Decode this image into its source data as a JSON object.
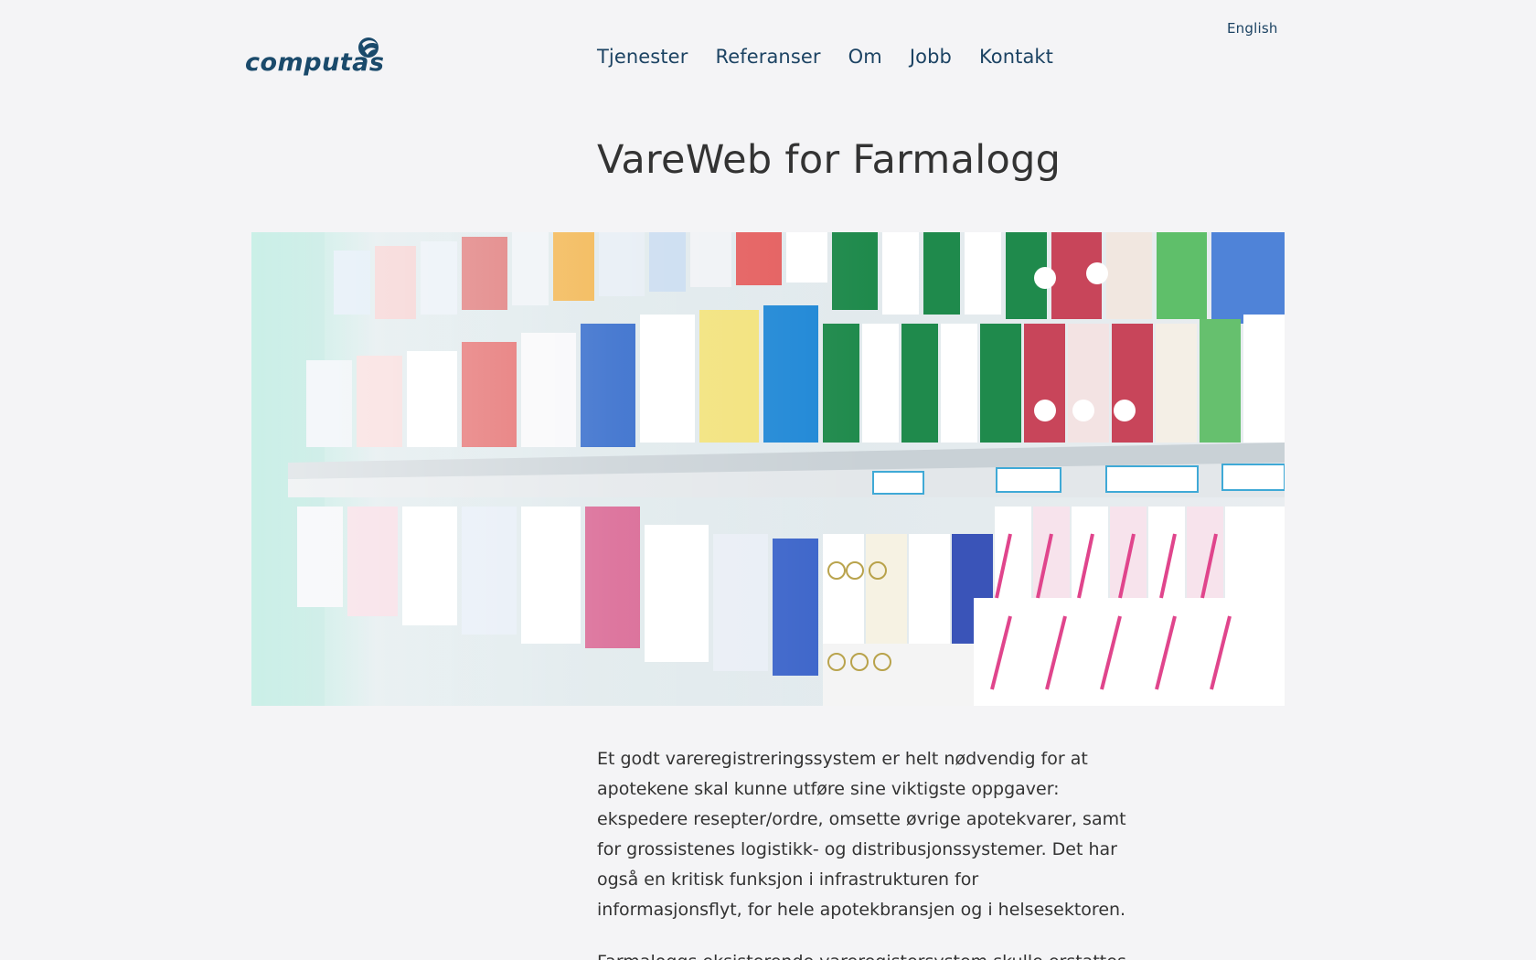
{
  "header": {
    "logo_text": "computas",
    "language_link": "English",
    "nav": [
      {
        "label": "Tjenester"
      },
      {
        "label": "Referanser"
      },
      {
        "label": "Om"
      },
      {
        "label": "Jobb"
      },
      {
        "label": "Kontakt"
      }
    ]
  },
  "main": {
    "title": "VareWeb for Farmalogg",
    "paragraphs": [
      "Et godt vareregistreringssystem er helt nødvendig for at apotekene skal kunne utføre sine viktigste oppgaver: ekspedere resepter/ordre, omsette øvrige apotekvarer, samt for grossistenes logistikk- og distribusjonssystemer. Det har også en kritisk funksjon i infrastrukturen for informasjonsflyt, for hele apotekbransjen og i helsesektoren.",
      "Farmaloggs eksisterende vareregistersystem skulle erstattes"
    ]
  },
  "colors": {
    "background": "#f4f4f6",
    "nav_text": "#1c4363",
    "logo": "#1a4a6b",
    "body_text": "#333333"
  }
}
